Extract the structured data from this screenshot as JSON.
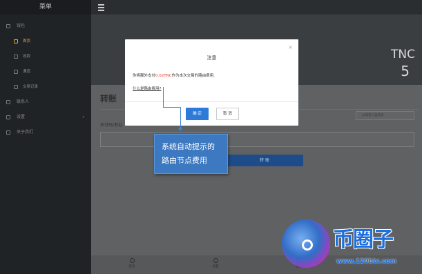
{
  "sidebar": {
    "title": "菜单",
    "wallet": "钱包",
    "items": [
      {
        "label": "首页"
      },
      {
        "label": "收款"
      },
      {
        "label": "通道"
      },
      {
        "label": "交易记录"
      }
    ],
    "contacts": "联系人",
    "settings": "设置",
    "about": "关于我们"
  },
  "header": {
    "token": "TNC",
    "count": "5"
  },
  "main": {
    "title": "转账",
    "pay_label": "支付码/地址",
    "select_placeholder": "从联系人里选择",
    "transfer_button": "转 账",
    "tabs": [
      {
        "label": "首页"
      },
      {
        "label": "设置"
      },
      {
        "label": "通道"
      }
    ]
  },
  "modal": {
    "title": "注意",
    "close": "×",
    "body_prefix": "你将额外支付",
    "fee": "0.02TNC",
    "body_suffix": "作为本次交易的路由费用.",
    "link": "什么是路由费用?",
    "ok": "确 定",
    "cancel": "取 消"
  },
  "annotation": {
    "line1": "系统自动提示的",
    "line2": "路由节点费用"
  },
  "watermark": {
    "brand": "币圈子",
    "url": "www.120btc.com",
    "accent": "#1b6fe0"
  }
}
